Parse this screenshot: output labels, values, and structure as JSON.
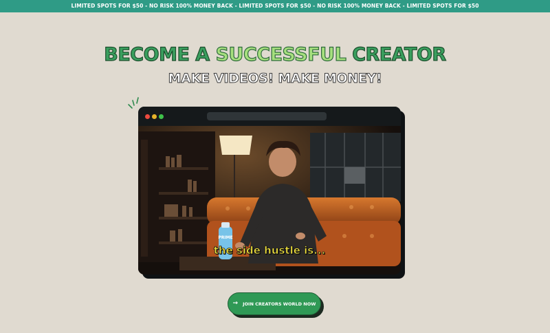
{
  "banner": {
    "text": "LIMITED SPOTS FOR $50 - NO RISK 100% MONEY BACK - LIMITED SPOTS FOR $50 - NO RISK 100% MONEY BACK - LIMITED SPOTS FOR $50"
  },
  "hero": {
    "headline_pre": "BECOME A ",
    "headline_highlight": "SUCCESSFUL",
    "headline_post": " CREATOR",
    "subheadline": "MAKE VIDEOS! MAKE MONEY!"
  },
  "video": {
    "caption": "the side hustle is...",
    "bottle_label": "PRIME"
  },
  "cta": {
    "label": "JOIN CREATORS WORLD NOW",
    "icon": "arrow-right-icon"
  },
  "colors": {
    "banner": "#2f9b86",
    "background": "#e0dad0",
    "accent_green": "#3a9f5e",
    "highlight_green": "#a6df7e",
    "cta_green": "#2f9955",
    "caption_yellow": "#f2e23a"
  }
}
